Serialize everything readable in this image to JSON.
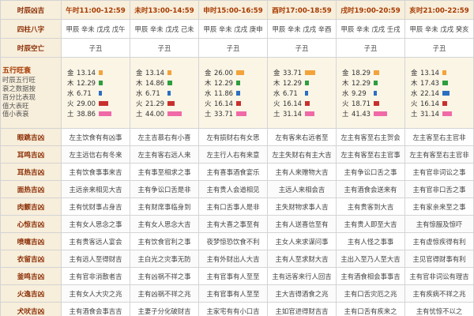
{
  "header": {
    "corner": "时辰凶吉",
    "hours": [
      "午时11:00-12:59",
      "未时13:00-14:59",
      "申时15:00-16:59",
      "酉时17:00-18:59",
      "戌时19:00-20:59",
      "亥时21:00-22:59"
    ]
  },
  "rows_top": [
    {
      "label": "四柱八字",
      "cells": [
        "甲辰 辛未 戊戌 戊午",
        "甲辰 辛未 戊戌 己未",
        "甲辰 辛未 戊戌 庚申",
        "甲辰 辛未 戊戌 辛酉",
        "甲辰 辛未 戊戌 壬戌",
        "甲辰 辛未 戊戌 癸亥"
      ]
    },
    {
      "label": "时辰空亡",
      "cells": [
        "子丑",
        "子丑",
        "子丑",
        "子丑",
        "子丑",
        "子丑"
      ]
    }
  ],
  "wuxing": {
    "label_lines": [
      "五行旺衰",
      "时辰五行旺",
      "衰之数据按",
      "百分比表现",
      "值大表旺",
      "值小表衰"
    ],
    "names": [
      "金",
      "木",
      "水",
      "火",
      "土"
    ],
    "colors": {
      "金": "#f2a33a",
      "木": "#2e9e3e",
      "水": "#2b6fc2",
      "火": "#c8302e",
      "土": "#f06aa8"
    },
    "columns": [
      {
        "金": 13.14,
        "木": 12.29,
        "水": 6.71,
        "火": 29.0,
        "土": 38.86
      },
      {
        "金": 13.14,
        "木": 14.86,
        "水": 6.71,
        "火": 21.29,
        "土": 44.0
      },
      {
        "金": 26.0,
        "木": 12.29,
        "水": 11.86,
        "火": 16.14,
        "土": 33.71
      },
      {
        "金": 33.71,
        "木": 12.29,
        "水": 6.71,
        "火": 16.14,
        "土": 31.14
      },
      {
        "金": 18.29,
        "木": 12.29,
        "水": 9.29,
        "火": 18.71,
        "土": 41.43
      },
      {
        "金": 13.14,
        "木": 17.43,
        "水": 22.14,
        "火": 16.14,
        "土": 31.14
      }
    ],
    "display": [
      {
        "金": "13.14",
        "木": "12.29",
        "水": "6.71",
        "火": "29.00",
        "土": "38.86"
      },
      {
        "金": "13.14",
        "木": "14.86",
        "水": "6.71",
        "火": "21.29",
        "土": "44.00"
      },
      {
        "金": "26.00",
        "木": "12.29",
        "水": "11.86",
        "火": "16.14",
        "土": "33.71"
      },
      {
        "金": "33.71",
        "木": "12.29",
        "水": "6.71",
        "火": "16.14",
        "土": "31.14"
      },
      {
        "金": "18.29",
        "木": "12.29",
        "水": "9.29",
        "火": "18.71",
        "土": "41.43"
      },
      {
        "金": "13.14",
        "木": "17.43",
        "水": "22.14",
        "火": "16.14",
        "土": "31.14"
      }
    ]
  },
  "rows_body": [
    {
      "label": "眼跳吉凶",
      "cells": [
        "左主饮食有有凶事",
        "左主吉慕右有小喜",
        "左有损财右有女思",
        "左有客来右远者至",
        "左主有客至右主贺会",
        "左主客至右主官非"
      ]
    },
    {
      "label": "耳鸣吉凶",
      "cells": [
        "左主远信右有冬来",
        "左主有客右远人来",
        "左主行人右有来意",
        "左主失财右有主大吉",
        "左主有客至右主官事",
        "左主有客至右主官非"
      ]
    },
    {
      "label": "耳热吉凶",
      "cells": [
        "主有饮食事事来吉",
        "主有事至相求之事",
        "主有喜事酒食宴乐",
        "主有人来赠物大吉",
        "主有争讼口舌之事",
        "主有官非词讼之事"
      ]
    },
    {
      "label": "面热吉凶",
      "cells": [
        "主远亲来相见大吉",
        "主有争讼口舌是非",
        "主有贵人会道相见",
        "主远人来相会吉",
        "主有酒食会送来有",
        "主有官非口舌之事"
      ]
    },
    {
      "label": "肉颤吉凶",
      "cells": [
        "主有忧财事占身吉",
        "主有财席事临身到",
        "主有口舌事人是非",
        "主失财物求事人吉",
        "主有贵客到大吉",
        "主有家亲来至之事"
      ]
    },
    {
      "label": "心惊吉凶",
      "cells": [
        "主有女人思念之事",
        "主有女人思念大吉",
        "主有大喜之事至有",
        "主有人送喜信至有",
        "主有贵人即至大吉",
        "主有惊服及惊吓"
      ]
    },
    {
      "label": "喷嚏吉凶",
      "cells": [
        "主有贵客远人宴会",
        "主有饮食官利之事",
        "夜梦惊恐饮食不利",
        "主女人来求谋问事",
        "主有人怪之事事",
        "主有虚惊疾得有利"
      ]
    },
    {
      "label": "衣留吉凶",
      "cells": [
        "主有远人至得财吉",
        "主白光之灾事无防",
        "主有外财出人大吉",
        "主有人至求财大吉",
        "主出入至乃人至大吉",
        "主见官得财事有利"
      ]
    },
    {
      "label": "釜鸣吉凶",
      "cells": [
        "主有官非消散者吉",
        "主有凶祸不祥之事",
        "主有官事有人至至",
        "主有远客来行人回吉",
        "主有酒食相会事事吉",
        "主有官非词讼有理吉"
      ]
    },
    {
      "label": "火逸吉凶",
      "cells": [
        "主有女人大灾之兆",
        "主有凶祸不祥之兆",
        "主有官事有人至至",
        "主大吉得酒食之兆",
        "主有口舌灾厄之兆",
        "主有疾病不祥之兆"
      ]
    },
    {
      "label": "犬吠吉凶",
      "cells": [
        "主有酒食会事吉吉",
        "主妻子分化破财吉",
        "主家宅有有小口吉",
        "主如官进得财吉吉",
        "主有口舌有疾来之",
        "主有忧惊不以之"
      ]
    }
  ]
}
